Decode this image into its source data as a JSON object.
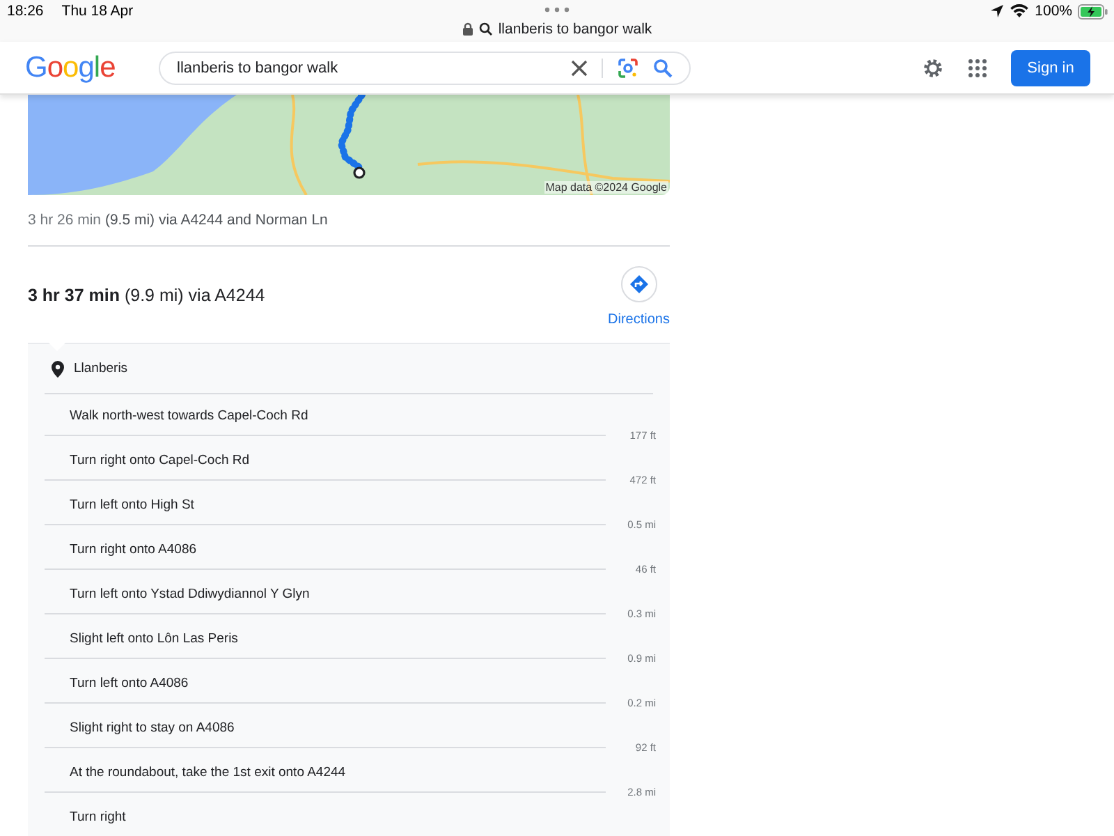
{
  "status_bar": {
    "time": "18:26",
    "date": "Thu 18 Apr",
    "battery": "100%",
    "url": "llanberis to bangor walk"
  },
  "header": {
    "logo": "Google",
    "search_value": "llanberis to bangor walk",
    "sign_in": "Sign in"
  },
  "map": {
    "attribution": "Map data ©2024 Google"
  },
  "alt_route": {
    "time": "3 hr 26 min",
    "detail": "(9.5 mi) via A4244 and Norman Ln"
  },
  "route": {
    "summary": "**3 hr 37 min** (9.9 mi) via A4244",
    "directions_label": "Directions"
  },
  "start": "Llanberis",
  "steps": [
    {
      "text": "Walk north-west towards Capel-Coch Rd",
      "distance": "177 ft"
    },
    {
      "text": "Turn right onto Capel-Coch Rd",
      "distance": "472 ft"
    },
    {
      "text": "Turn left onto High St",
      "distance": "0.5 mi"
    },
    {
      "text": "Turn right onto A4086",
      "distance": "46 ft"
    },
    {
      "text": "Turn left onto Ystad Ddiwydiannol Y Glyn",
      "distance": "0.3 mi"
    },
    {
      "text": "Slight left onto Lôn Las Peris",
      "distance": "0.9 mi"
    },
    {
      "text": "Turn left onto A4086",
      "distance": "0.2 mi"
    },
    {
      "text": "Slight right to stay on A4086",
      "distance": "92 ft"
    },
    {
      "text": "At the roundabout, take the 1st exit onto A4244",
      "distance": "2.8 mi"
    },
    {
      "text": "Turn right"
    }
  ]
}
